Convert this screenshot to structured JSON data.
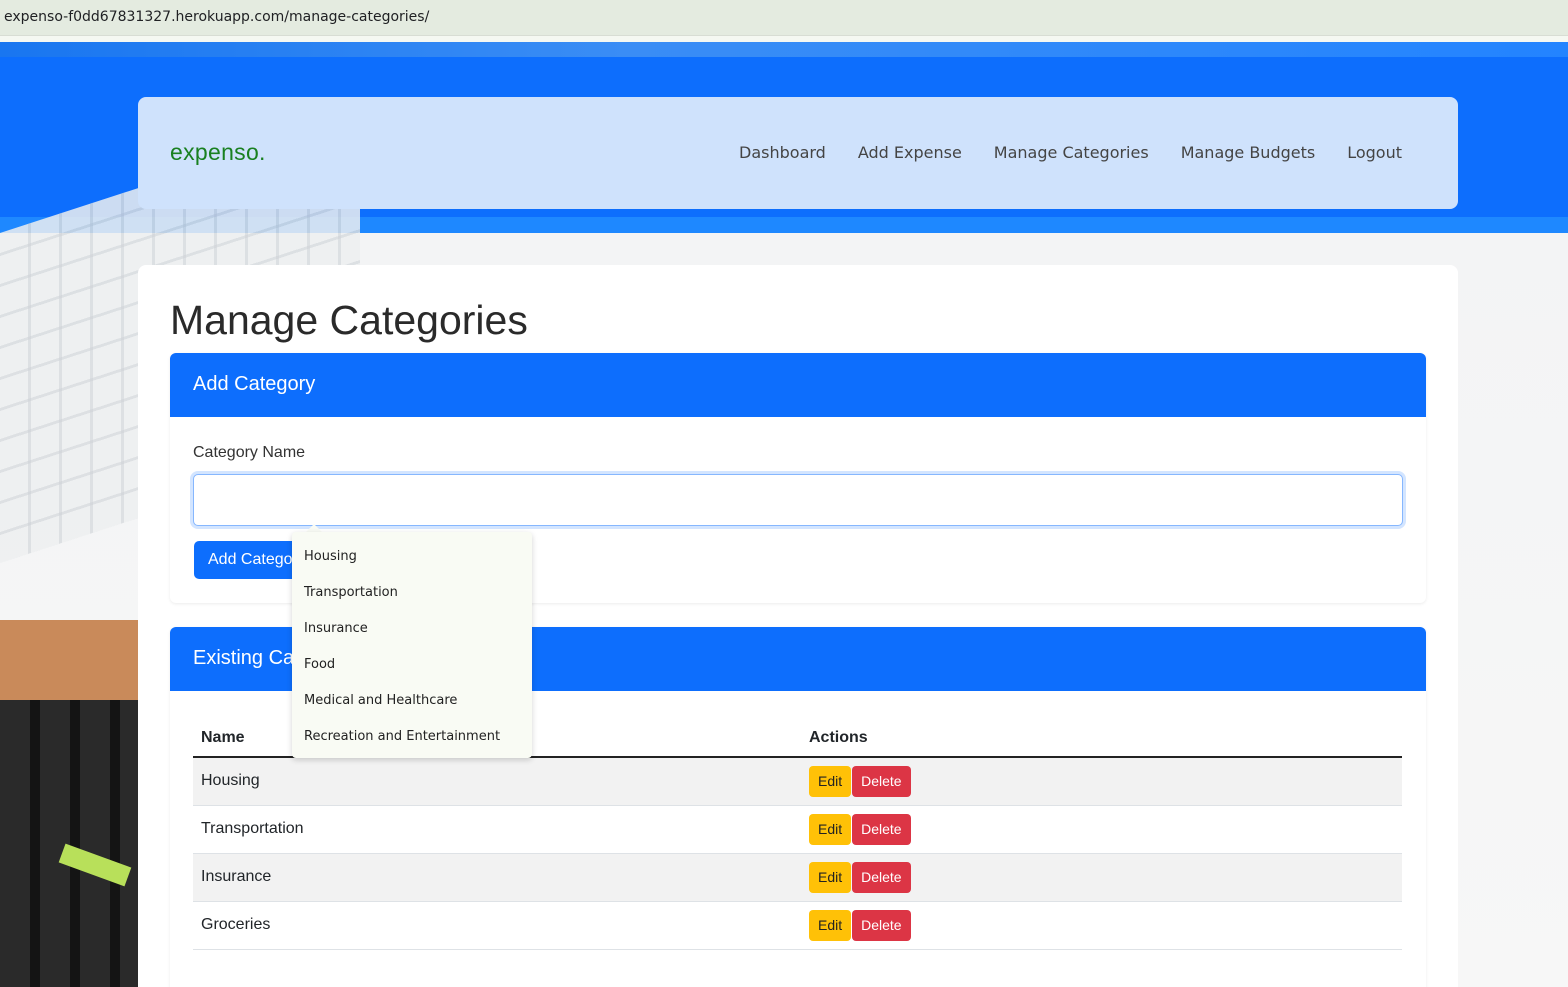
{
  "browser": {
    "url": "expenso-f0dd67831327.herokuapp.com/manage-categories/"
  },
  "navbar": {
    "brand": "expenso.",
    "links": [
      "Dashboard",
      "Add Expense",
      "Manage Categories",
      "Manage Budgets",
      "Logout"
    ]
  },
  "page": {
    "title": "Manage Categories"
  },
  "add_category": {
    "header": "Add Category",
    "field_label": "Category Name",
    "field_value": "",
    "button_label": "Add Category"
  },
  "existing": {
    "header": "Existing Categories",
    "columns": [
      "Name",
      "Actions"
    ],
    "rows": [
      {
        "name": "Housing"
      },
      {
        "name": "Transportation"
      },
      {
        "name": "Insurance"
      },
      {
        "name": "Groceries"
      }
    ],
    "edit_label": "Edit",
    "delete_label": "Delete"
  },
  "autocomplete": {
    "options": [
      "Housing",
      "Transportation",
      "Insurance",
      "Food",
      "Medical and Healthcare",
      "Recreation and Entertainment"
    ]
  },
  "colors": {
    "primary": "#0d6efd",
    "brand": "#198020",
    "warning": "#ffc107",
    "danger": "#dc3545",
    "navbar_bg": "#cfe2fc"
  }
}
